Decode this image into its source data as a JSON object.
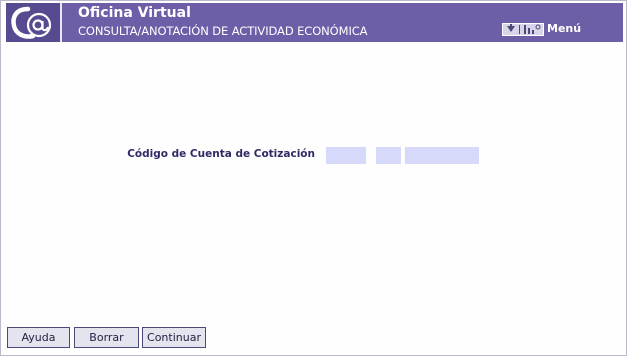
{
  "header": {
    "logo_icon": "at-sign-logo-icon",
    "title": "Oficina Virtual",
    "subtitle": "CONSULTA/ANOTACIÓN DE ACTIVIDAD ECONÓMICA",
    "menu": {
      "label": "Menú",
      "icons": [
        "arrow-down-icon",
        "bar-chart-icon"
      ]
    },
    "colors": {
      "header_bg": "#6e5ea7",
      "logo_bg": "#574a91"
    }
  },
  "form": {
    "ccc_label": "Código de Cuenta de Cotización",
    "ccc_fields": [
      {
        "name": "ccc-regimen",
        "value": ""
      },
      {
        "name": "ccc-provincia",
        "value": ""
      },
      {
        "name": "ccc-numero",
        "value": ""
      }
    ],
    "input_bg": "#d6d9fa",
    "label_color": "#2e2a66"
  },
  "footer": {
    "buttons": {
      "help": "Ayuda",
      "clear": "Borrar",
      "continue": "Continuar"
    }
  }
}
